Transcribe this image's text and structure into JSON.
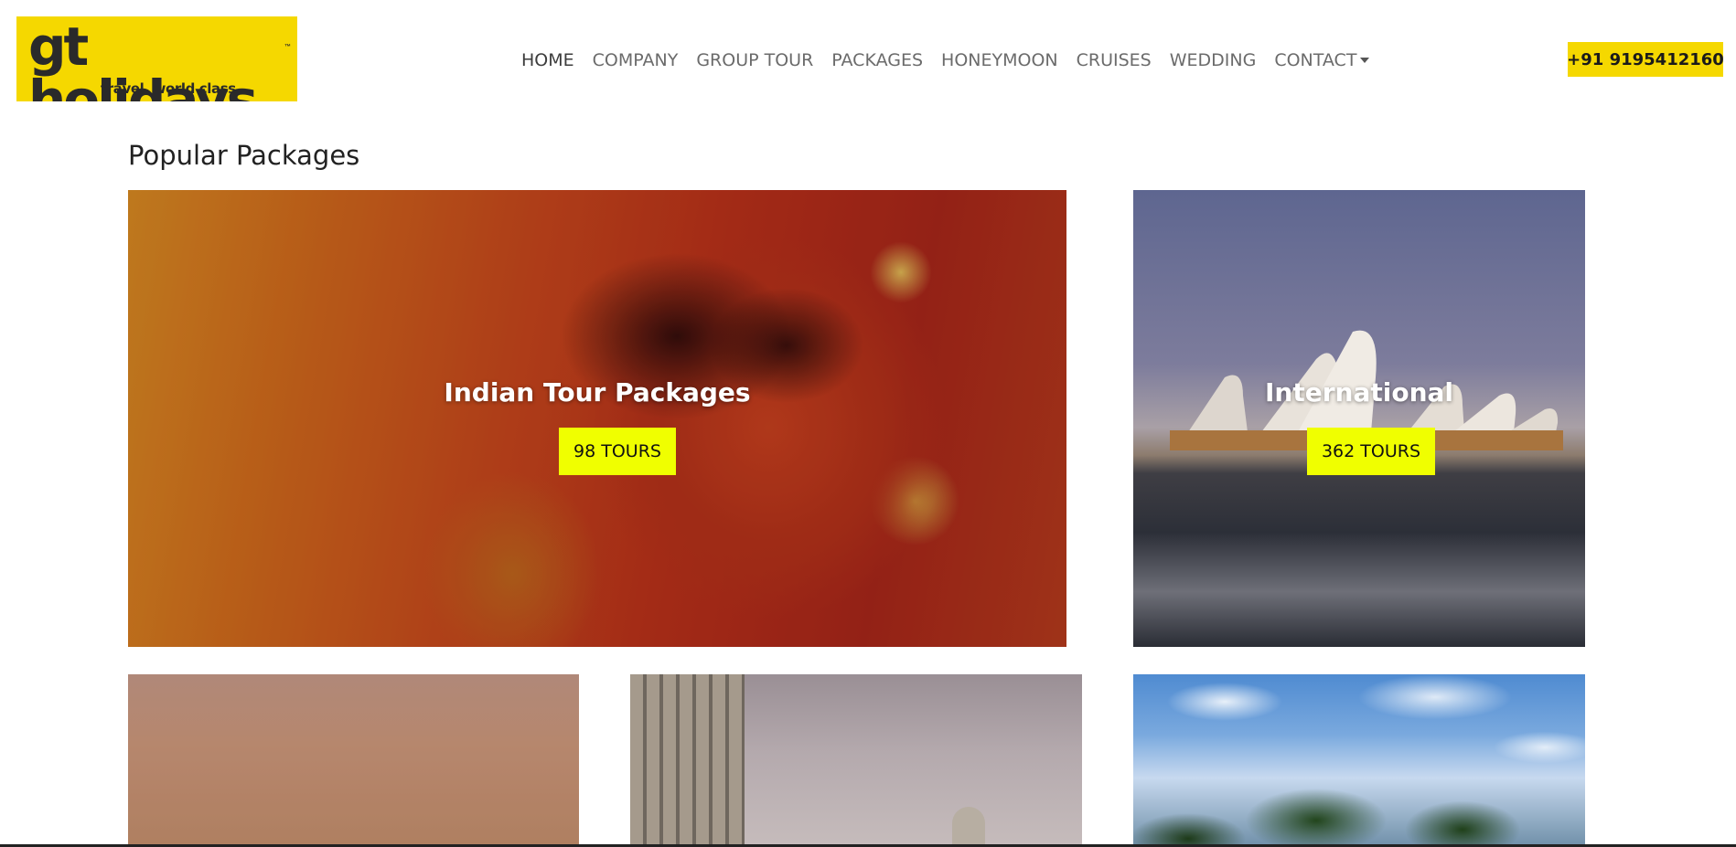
{
  "brand": {
    "logo_text": "gt holidays",
    "logo_tagline": "travel, world class",
    "logo_tm": "™",
    "accent_color": "#f5d800"
  },
  "nav": {
    "items": [
      {
        "label": "HOME",
        "active": true
      },
      {
        "label": "COMPANY"
      },
      {
        "label": "GROUP TOUR"
      },
      {
        "label": "PACKAGES"
      },
      {
        "label": "HONEYMOON"
      },
      {
        "label": "CRUISES"
      },
      {
        "label": "WEDDING"
      },
      {
        "label": "CONTACT",
        "dropdown": true
      }
    ],
    "phone": "+91 9195412160"
  },
  "section": {
    "title": "Popular Packages"
  },
  "packages": [
    {
      "title": "Indian Tour Packages",
      "tours": "98 TOURS",
      "image": "kathakali-dancer-face-photo"
    },
    {
      "title": "International",
      "tours": "362 TOURS",
      "image": "sydney-opera-house-photo"
    },
    {
      "image": "sunset-sky-photo"
    },
    {
      "image": "city-building-dome-photo"
    },
    {
      "image": "palm-trees-blue-sky-photo"
    }
  ],
  "colors": {
    "tours_button": "#f0ff00"
  }
}
